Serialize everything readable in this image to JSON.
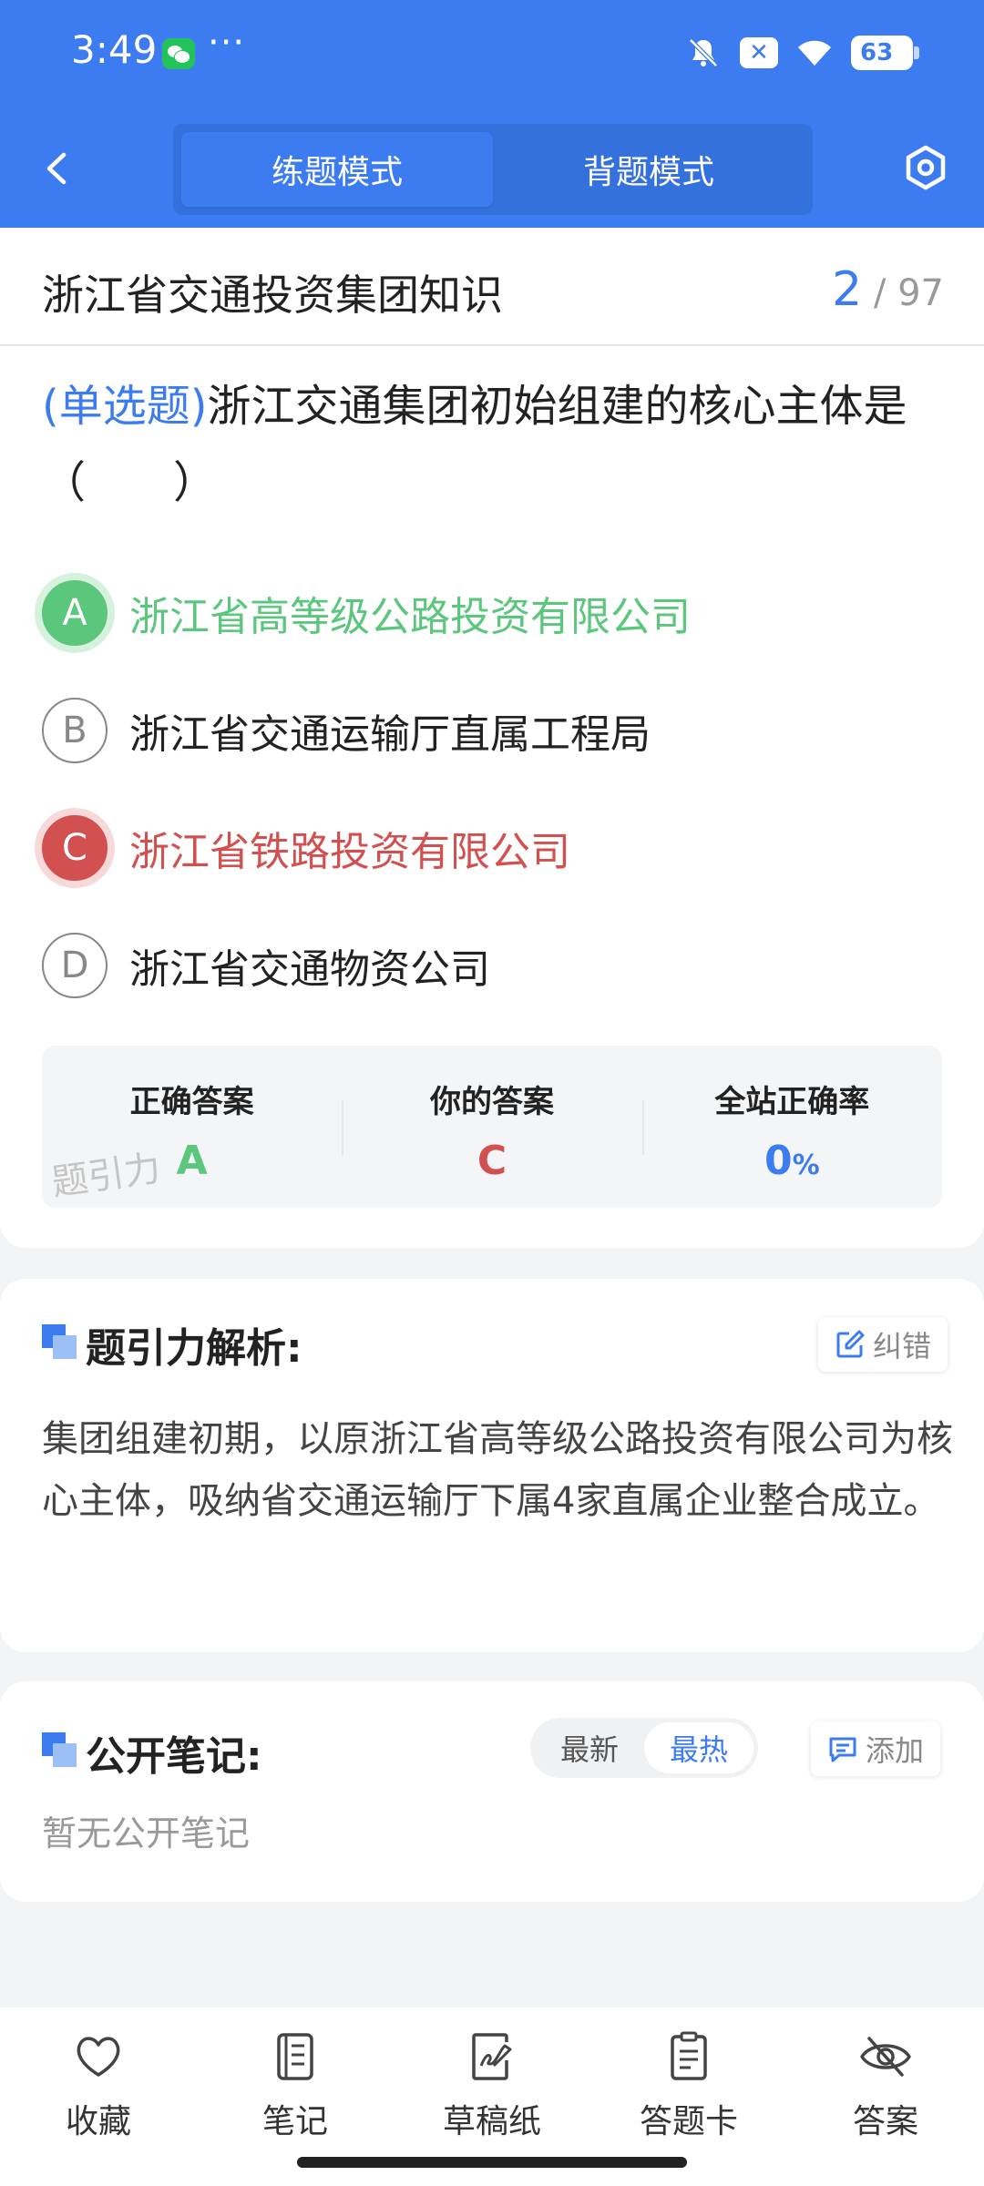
{
  "status_bar": {
    "time": "3:49",
    "more": "···",
    "battery": "63"
  },
  "header": {
    "tabs": [
      {
        "label": "练题模式",
        "active": true
      },
      {
        "label": "背题模式",
        "active": false
      }
    ]
  },
  "title_bar": {
    "title": "浙江省交通投资集团知识",
    "current": "2",
    "separator": "/",
    "total": "97"
  },
  "question": {
    "type_label": "(单选题)",
    "stem": "浙江交通集团初始组建的核心主体是（　　）",
    "options": [
      {
        "letter": "A",
        "text": "浙江省高等级公路投资有限公司",
        "state": "correct"
      },
      {
        "letter": "B",
        "text": "浙江省交通运输厅直属工程局",
        "state": "normal"
      },
      {
        "letter": "C",
        "text": "浙江省铁路投资有限公司",
        "state": "wrong"
      },
      {
        "letter": "D",
        "text": "浙江省交通物资公司",
        "state": "normal"
      }
    ]
  },
  "answer_summary": {
    "correct_label": "正确答案",
    "correct_value": "A",
    "yours_label": "你的答案",
    "yours_value": "C",
    "rate_label": "全站正确率",
    "rate_value": "0",
    "rate_unit": "%",
    "watermark": "题引力"
  },
  "analysis": {
    "title": "题引力解析:",
    "report_label": "纠错",
    "text": "集团组建初期，以原浙江省高等级公路投资有限公司为核心主体，吸纳省交通运输厅下属4家直属企业整合成立。"
  },
  "notes": {
    "title": "公开笔记:",
    "sort_options": [
      "最新",
      "最热"
    ],
    "active_sort": "最热",
    "add_label": "添加",
    "empty_text": "暂无公开笔记"
  },
  "bottom_nav": [
    {
      "label": "收藏",
      "icon": "heart-icon"
    },
    {
      "label": "笔记",
      "icon": "notebook-icon"
    },
    {
      "label": "草稿纸",
      "icon": "draft-icon"
    },
    {
      "label": "答题卡",
      "icon": "answer-sheet-icon"
    },
    {
      "label": "答案",
      "icon": "eye-off-icon"
    }
  ],
  "colors": {
    "primary": "#3d7cf0",
    "correct": "#5bc77d",
    "wrong": "#d2504f"
  }
}
